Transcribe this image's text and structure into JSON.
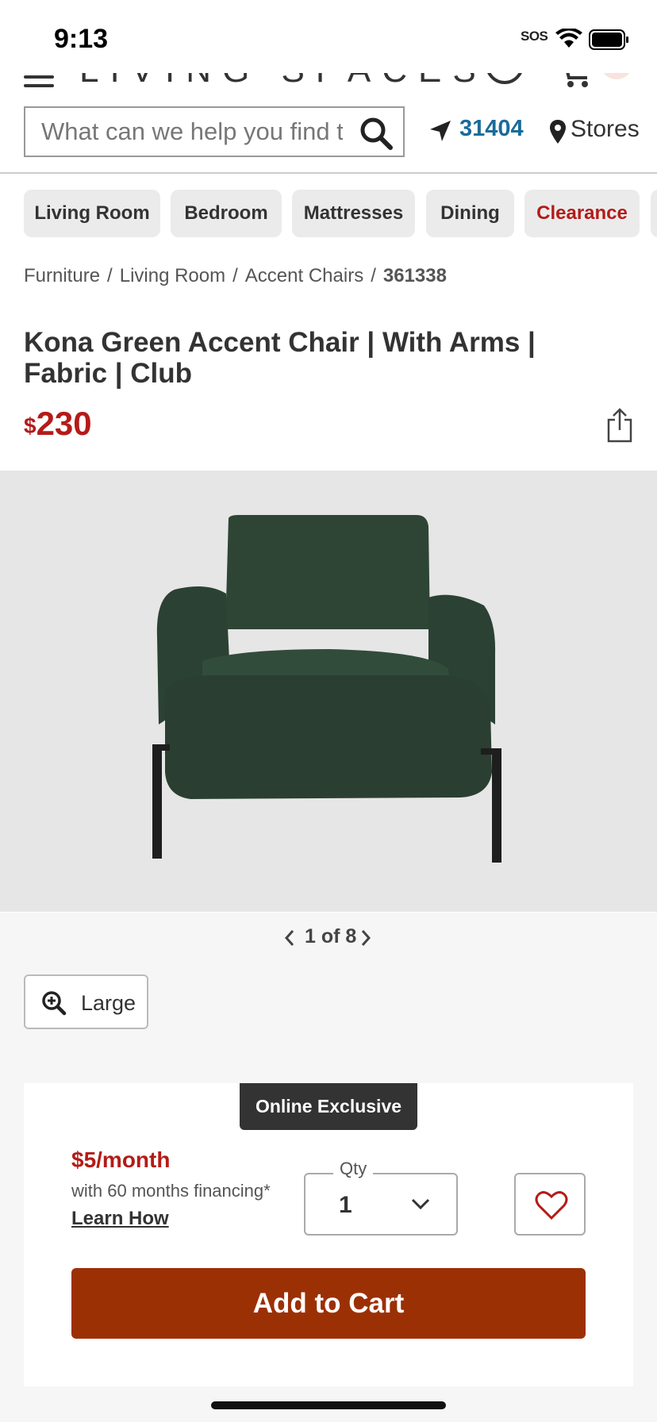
{
  "status_bar": {
    "time": "9:13",
    "sos": "SOS"
  },
  "header": {
    "logo": "LIVING SPACES",
    "search_placeholder": "What can we help you find today?",
    "zip_code": "31404",
    "stores_label": "Stores"
  },
  "categories": [
    "Living Room",
    "Bedroom",
    "Mattresses",
    "Dining",
    "Clearance"
  ],
  "breadcrumb": {
    "items": [
      "Furniture",
      "Living Room",
      "Accent Chairs"
    ],
    "current": "361338",
    "separator": "/"
  },
  "product": {
    "title": "Kona Green Accent Chair | With Arms | Fabric | Club",
    "price_currency": "$",
    "price_amount": "230",
    "image_pager": "1 of 8",
    "large_view_label": "Large"
  },
  "purchase": {
    "badge": "Online Exclusive",
    "monthly_price": "$5/month",
    "financing_note": "with 60 months financing*",
    "learn_how": "Learn How",
    "qty_label": "Qty",
    "qty_value": "1",
    "add_to_cart": "Add to Cart"
  },
  "colors": {
    "accent_red": "#b41b18",
    "cta_brown": "#9c3005",
    "link_blue": "#1a6b9a",
    "chair_green": "#2a3f31"
  }
}
